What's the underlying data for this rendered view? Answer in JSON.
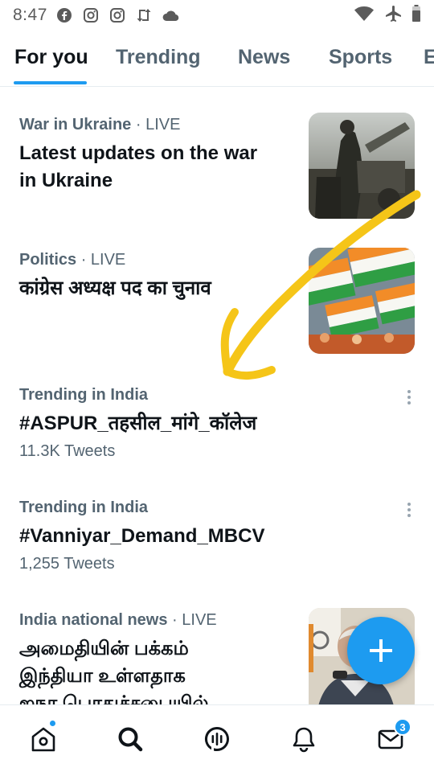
{
  "status_bar": {
    "time": "8:47",
    "left_icons": [
      "facebook-icon",
      "instagram-icon",
      "instagram-icon",
      "retweet-icon",
      "cloud-icon"
    ],
    "right_icons": [
      "wifi-icon",
      "airplane-icon",
      "battery-icon"
    ]
  },
  "tabs": [
    {
      "label": "For you",
      "active": true
    },
    {
      "label": "Trending",
      "active": false
    },
    {
      "label": "News",
      "active": false
    },
    {
      "label": "Sports",
      "active": false
    },
    {
      "label": "E",
      "active": false
    }
  ],
  "feed": {
    "items": [
      {
        "category": "War in Ukraine",
        "status": " · LIVE",
        "headline_lines": [
          "Latest updates on the war",
          "in Ukraine"
        ],
        "has_image": true
      },
      {
        "category": "Politics",
        "status": " · LIVE",
        "headline_lines": [
          "कांग्रेस अध्यक्ष पद का चुनाव"
        ],
        "has_image": true
      },
      {
        "category": "Trending in India",
        "headline": "#ASPUR_तहसील_मांगे_कॉलेज",
        "count": "11.3K Tweets"
      },
      {
        "category": "Trending in India",
        "headline": "#Vanniyar_Demand_MBCV",
        "count": "1,255 Tweets"
      },
      {
        "category": "India national news",
        "status": " · LIVE",
        "headline_lines": [
          "அமைதியின் பக்கம்",
          "இந்தியா உள்ளதாக",
          "ஐநா பொதுச்சபையில்"
        ],
        "has_image": true
      }
    ]
  },
  "fab": {
    "icon": "plus-icon"
  },
  "bottom_nav": {
    "items": [
      "home-icon",
      "search-icon",
      "spaces-icon",
      "notifications-icon",
      "messages-icon"
    ],
    "messages_badge": "3"
  },
  "colors": {
    "accent": "#1d9bf0",
    "text": "#0f1419",
    "secondary": "#536471",
    "annotation": "#f5c518"
  }
}
